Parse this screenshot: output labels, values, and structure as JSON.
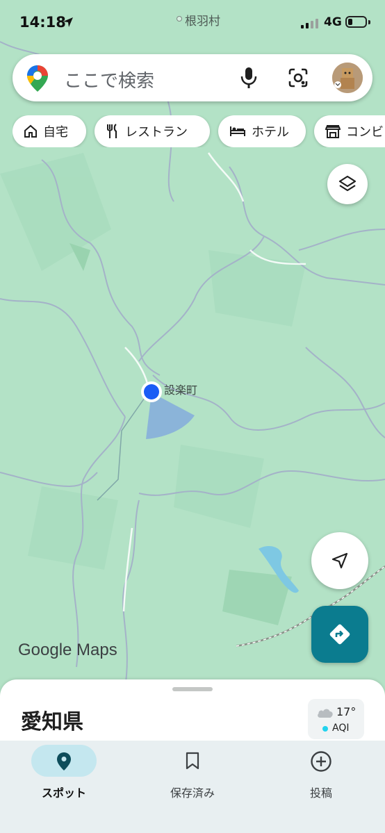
{
  "status_bar": {
    "time": "14:18",
    "network": "4G"
  },
  "map": {
    "village_label": "根羽村",
    "town_label": "設楽町",
    "logo": "Google Maps",
    "accent_color": "#0b7c8f",
    "location_dot_color": "#1a5cf5"
  },
  "search": {
    "placeholder": "ここで検索"
  },
  "chips": [
    {
      "label": "自宅",
      "icon": "home-icon"
    },
    {
      "label": "レストラン",
      "icon": "restaurant-icon"
    },
    {
      "label": "ホテル",
      "icon": "hotel-icon"
    },
    {
      "label": "コンビ",
      "icon": "store-icon"
    }
  ],
  "sheet": {
    "title": "愛知県",
    "temperature": "17°",
    "aqi_label": "AQI"
  },
  "nav": [
    {
      "label": "スポット",
      "icon": "pin-icon",
      "active": true
    },
    {
      "label": "保存済み",
      "icon": "bookmark-icon",
      "active": false
    },
    {
      "label": "投稿",
      "icon": "add-circle-icon",
      "active": false
    }
  ]
}
